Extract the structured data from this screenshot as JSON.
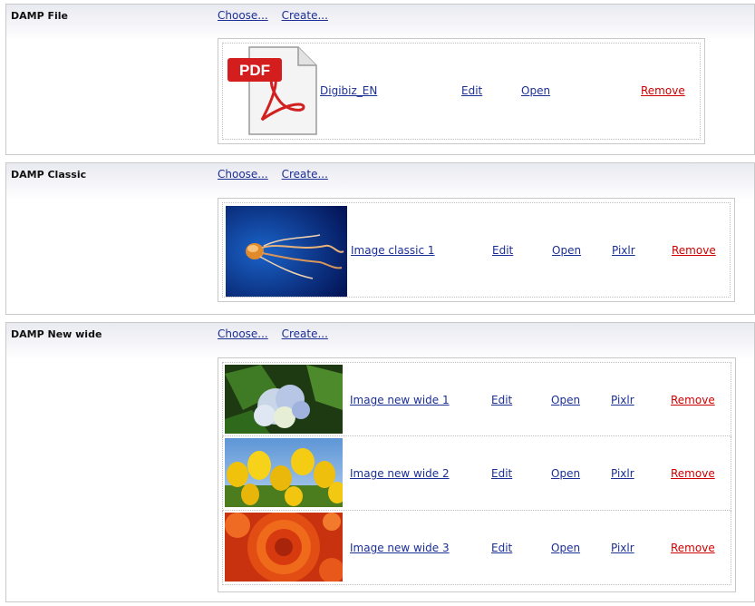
{
  "sections": [
    {
      "label": "DAMP File",
      "choose": "Choose...",
      "create": "Create...",
      "items": [
        {
          "name": "Digibiz_EN",
          "edit": "Edit",
          "open": "Open",
          "remove": "Remove",
          "thumb": "pdf-file-icon",
          "thumb_text": "PDF"
        }
      ]
    },
    {
      "label": "DAMP Classic",
      "choose": "Choose...",
      "create": "Create...",
      "items": [
        {
          "name": "Image classic 1",
          "edit": "Edit",
          "open": "Open",
          "pixlr": "Pixlr",
          "remove": "Remove",
          "thumb": "jellyfish-image"
        }
      ]
    },
    {
      "label": "DAMP New wide",
      "choose": "Choose...",
      "create": "Create...",
      "items": [
        {
          "name": "Image new wide 1",
          "edit": "Edit",
          "open": "Open",
          "pixlr": "Pixlr",
          "remove": "Remove",
          "thumb": "hydrangea-image"
        },
        {
          "name": "Image new wide 2",
          "edit": "Edit",
          "open": "Open",
          "pixlr": "Pixlr",
          "remove": "Remove",
          "thumb": "tulips-image"
        },
        {
          "name": "Image new wide 3",
          "edit": "Edit",
          "open": "Open",
          "pixlr": "Pixlr",
          "remove": "Remove",
          "thumb": "red-flower-image"
        }
      ]
    }
  ],
  "colors": {
    "link": "#1b2f94",
    "remove": "#cc0000",
    "border": "#c8c8c8"
  }
}
